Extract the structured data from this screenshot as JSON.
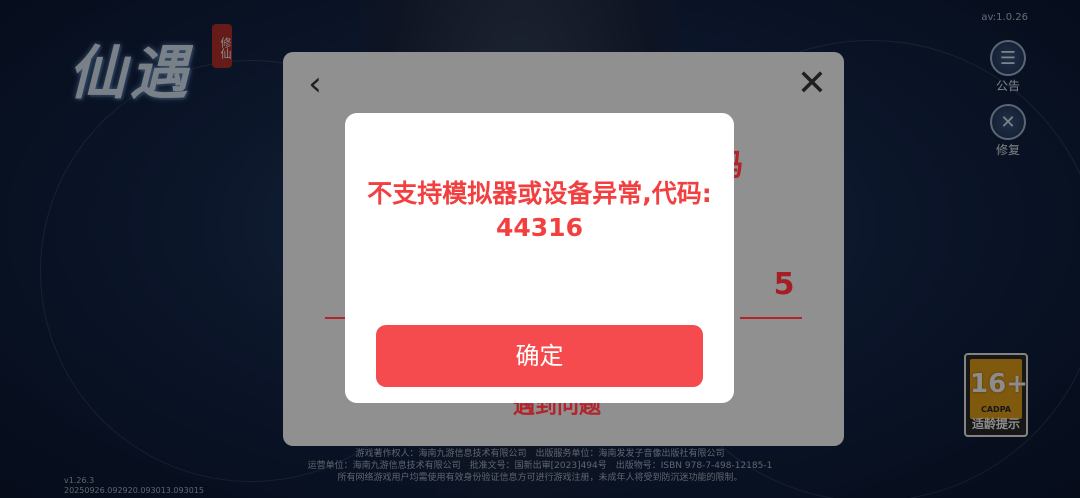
{
  "background": {
    "logo_text": "仙遇",
    "logo_seal": "修仙",
    "version_top": "av:1.0.26",
    "side_buttons": [
      {
        "label": "公告",
        "icon": "announcement-icon"
      },
      {
        "label": "修复",
        "icon": "repair-icon"
      }
    ],
    "age_rating": {
      "number": "16+",
      "org": "CADPA",
      "tip": "适龄提示"
    },
    "footer_lines": [
      "游戏著作权人：海南九游信息技术有限公司　出版服务单位：海南发发子音像出版社有限公司",
      "运营单位：海南九游信息技术有限公司　批准文号：国新出审[2023]494号　出版物号：ISBN 978-7-498-12185-1",
      "所有网络游戏用户均需使用有效身份验证信息方可进行游戏注册，未成年人将受到防沉迷功能的限制。"
    ],
    "version_bottom": [
      "v1.26.3",
      "20250926.092920.093013.093015"
    ]
  },
  "dialog": {
    "code_digit": "5",
    "peek_text": "遇到问题",
    "peek_right": "码"
  },
  "alert": {
    "message": "不支持模拟器或设备异常,代码:",
    "code": "44316",
    "confirm_label": "确定"
  },
  "colors": {
    "alert_text": "#f24040",
    "confirm_button": "#f54b4e",
    "overlay_panel": "#909090"
  }
}
